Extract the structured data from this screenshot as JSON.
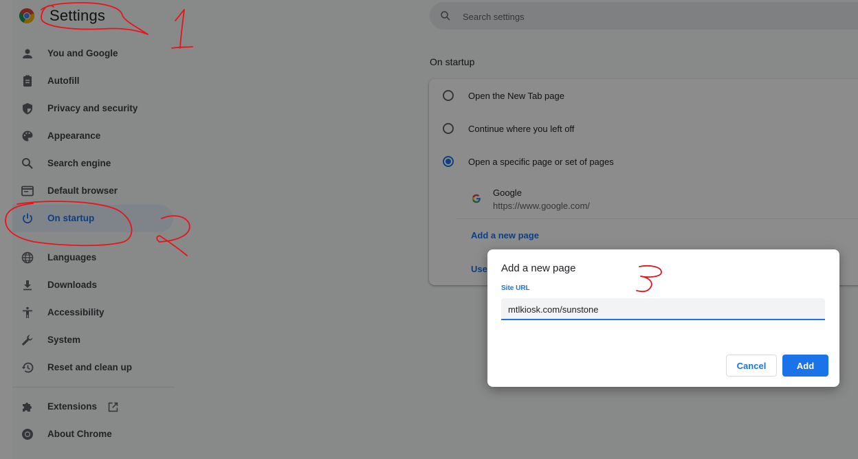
{
  "app": {
    "title": "Settings",
    "brand_accent": "#1a73e8",
    "search_placeholder": "Search settings"
  },
  "sidebar": {
    "items": [
      {
        "label": "You and Google",
        "icon": "person-icon"
      },
      {
        "label": "Autofill",
        "icon": "clipboard-icon"
      },
      {
        "label": "Privacy and security",
        "icon": "shield-icon"
      },
      {
        "label": "Appearance",
        "icon": "palette-icon"
      },
      {
        "label": "Search engine",
        "icon": "search-icon"
      },
      {
        "label": "Default browser",
        "icon": "browser-window-icon"
      },
      {
        "label": "On startup",
        "icon": "power-icon",
        "active": true
      },
      {
        "label": "Languages",
        "icon": "globe-icon"
      },
      {
        "label": "Downloads",
        "icon": "download-icon"
      },
      {
        "label": "Accessibility",
        "icon": "accessibility-icon"
      },
      {
        "label": "System",
        "icon": "wrench-icon"
      },
      {
        "label": "Reset and clean up",
        "icon": "history-icon"
      },
      {
        "label": "Extensions",
        "icon": "puzzle-icon",
        "trailing_icon": "open-in-new-icon"
      },
      {
        "label": "About Chrome",
        "icon": "chrome-logo-icon"
      }
    ]
  },
  "main": {
    "section_title": "On startup",
    "options": [
      {
        "label": "Open the New Tab page",
        "checked": false
      },
      {
        "label": "Continue where you left off",
        "checked": false
      },
      {
        "label": "Open a specific page or set of pages",
        "checked": true
      }
    ],
    "startup_page": {
      "name": "Google",
      "url": "https://www.google.com/",
      "icon": "google-g-icon"
    },
    "add_page_link": "Add a new page",
    "use_current_link": "Use"
  },
  "dialog": {
    "title": "Add a new page",
    "field_label": "Site URL",
    "field_value": "mtlkiosk.com/sunstone",
    "cancel_label": "Cancel",
    "add_label": "Add"
  },
  "annotations": {
    "ink_color": "#e8141b",
    "marks": [
      "1",
      "2",
      "3"
    ]
  }
}
